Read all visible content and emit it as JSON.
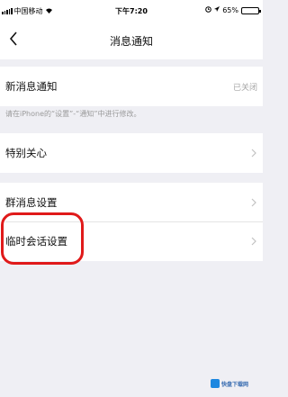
{
  "status_bar": {
    "carrier": "中国移动",
    "time": "下午7:20",
    "battery_percent": "65%",
    "battery_level": 0.65
  },
  "nav": {
    "title": "消息通知"
  },
  "settings": {
    "new_message": {
      "label": "新消息通知",
      "value": "已关闭"
    },
    "hint": "请在iPhone的“设置”-“通知”中进行修改。",
    "special_care": {
      "label": "特别关心"
    },
    "group_message": {
      "label": "群消息设置"
    },
    "temp_chat": {
      "label": "临时会话设置"
    }
  },
  "watermark": {
    "text": "快盘下载网"
  },
  "colors": {
    "background": "#efeff4",
    "highlight": "#e01a1a",
    "muted_text": "#a5a5a5"
  }
}
